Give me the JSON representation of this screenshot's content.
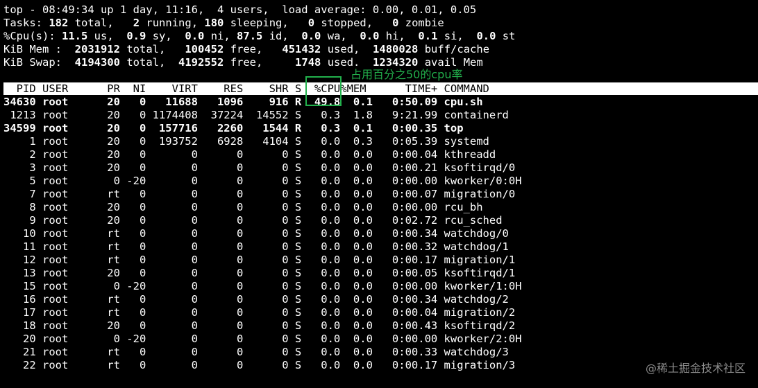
{
  "summary": {
    "line1": "top - 08:49:34 up 1 day, 11:16,  4 users,  load average: 0.00, 0.01, 0.05",
    "tasks": {
      "label": "Tasks:",
      "total": "182",
      "total_label": "total,",
      "running": "2",
      "running_label": "running,",
      "sleeping": "180",
      "sleeping_label": "sleeping,",
      "stopped": "0",
      "stopped_label": "stopped,",
      "zombie": "0",
      "zombie_label": "zombie"
    },
    "cpu": {
      "label": "%Cpu(s):",
      "us": "11.5",
      "us_label": "us,",
      "sy": "0.9",
      "sy_label": "sy,",
      "ni": "0.0",
      "ni_label": "ni,",
      "id": "87.5",
      "id_label": "id,",
      "wa": "0.0",
      "wa_label": "wa,",
      "hi": "0.0",
      "hi_label": "hi,",
      "si": "0.1",
      "si_label": "si,",
      "st": "0.0",
      "st_label": "st"
    },
    "mem": {
      "label": "KiB Mem :",
      "total": "2031912",
      "total_label": "total,",
      "free": "100452",
      "free_label": "free,",
      "used": "451432",
      "used_label": "used,",
      "buff": "1480028",
      "buff_label": "buff/cache"
    },
    "swap": {
      "label": "KiB Swap:",
      "total": "4194300",
      "total_label": "total,",
      "free": "4192552",
      "free_label": "free,",
      "used": "1748",
      "used_label": "used.",
      "avail": "1234320",
      "avail_label": "avail Mem"
    }
  },
  "columns": [
    "PID",
    "USER",
    "PR",
    "NI",
    "VIRT",
    "RES",
    "SHR",
    "S",
    "%CPU",
    "%MEM",
    "TIME+",
    "COMMAND"
  ],
  "processes": [
    {
      "pid": "34630",
      "user": "root",
      "pr": "20",
      "ni": "0",
      "virt": "11688",
      "res": "1096",
      "shr": "916",
      "s": "R",
      "cpu": "49.8",
      "mem": "0.1",
      "time": "0:50.09",
      "cmd": "cpu.sh",
      "bold": true
    },
    {
      "pid": "1213",
      "user": "root",
      "pr": "20",
      "ni": "0",
      "virt": "1174408",
      "res": "37224",
      "shr": "14552",
      "s": "S",
      "cpu": "0.3",
      "mem": "1.8",
      "time": "9:21.99",
      "cmd": "containerd",
      "bold": false
    },
    {
      "pid": "34599",
      "user": "root",
      "pr": "20",
      "ni": "0",
      "virt": "157716",
      "res": "2260",
      "shr": "1544",
      "s": "R",
      "cpu": "0.3",
      "mem": "0.1",
      "time": "0:00.35",
      "cmd": "top",
      "bold": true
    },
    {
      "pid": "1",
      "user": "root",
      "pr": "20",
      "ni": "0",
      "virt": "193752",
      "res": "6928",
      "shr": "4104",
      "s": "S",
      "cpu": "0.0",
      "mem": "0.3",
      "time": "0:05.39",
      "cmd": "systemd",
      "bold": false
    },
    {
      "pid": "2",
      "user": "root",
      "pr": "20",
      "ni": "0",
      "virt": "0",
      "res": "0",
      "shr": "0",
      "s": "S",
      "cpu": "0.0",
      "mem": "0.0",
      "time": "0:00.04",
      "cmd": "kthreadd",
      "bold": false
    },
    {
      "pid": "3",
      "user": "root",
      "pr": "20",
      "ni": "0",
      "virt": "0",
      "res": "0",
      "shr": "0",
      "s": "S",
      "cpu": "0.0",
      "mem": "0.0",
      "time": "0:00.21",
      "cmd": "ksoftirqd/0",
      "bold": false
    },
    {
      "pid": "5",
      "user": "root",
      "pr": "0",
      "ni": "-20",
      "virt": "0",
      "res": "0",
      "shr": "0",
      "s": "S",
      "cpu": "0.0",
      "mem": "0.0",
      "time": "0:00.00",
      "cmd": "kworker/0:0H",
      "bold": false
    },
    {
      "pid": "7",
      "user": "root",
      "pr": "rt",
      "ni": "0",
      "virt": "0",
      "res": "0",
      "shr": "0",
      "s": "S",
      "cpu": "0.0",
      "mem": "0.0",
      "time": "0:00.07",
      "cmd": "migration/0",
      "bold": false
    },
    {
      "pid": "8",
      "user": "root",
      "pr": "20",
      "ni": "0",
      "virt": "0",
      "res": "0",
      "shr": "0",
      "s": "S",
      "cpu": "0.0",
      "mem": "0.0",
      "time": "0:00.00",
      "cmd": "rcu_bh",
      "bold": false
    },
    {
      "pid": "9",
      "user": "root",
      "pr": "20",
      "ni": "0",
      "virt": "0",
      "res": "0",
      "shr": "0",
      "s": "S",
      "cpu": "0.0",
      "mem": "0.0",
      "time": "0:02.72",
      "cmd": "rcu_sched",
      "bold": false
    },
    {
      "pid": "10",
      "user": "root",
      "pr": "rt",
      "ni": "0",
      "virt": "0",
      "res": "0",
      "shr": "0",
      "s": "S",
      "cpu": "0.0",
      "mem": "0.0",
      "time": "0:00.34",
      "cmd": "watchdog/0",
      "bold": false
    },
    {
      "pid": "11",
      "user": "root",
      "pr": "rt",
      "ni": "0",
      "virt": "0",
      "res": "0",
      "shr": "0",
      "s": "S",
      "cpu": "0.0",
      "mem": "0.0",
      "time": "0:00.32",
      "cmd": "watchdog/1",
      "bold": false
    },
    {
      "pid": "12",
      "user": "root",
      "pr": "rt",
      "ni": "0",
      "virt": "0",
      "res": "0",
      "shr": "0",
      "s": "S",
      "cpu": "0.0",
      "mem": "0.0",
      "time": "0:00.17",
      "cmd": "migration/1",
      "bold": false
    },
    {
      "pid": "13",
      "user": "root",
      "pr": "20",
      "ni": "0",
      "virt": "0",
      "res": "0",
      "shr": "0",
      "s": "S",
      "cpu": "0.0",
      "mem": "0.0",
      "time": "0:00.05",
      "cmd": "ksoftirqd/1",
      "bold": false
    },
    {
      "pid": "15",
      "user": "root",
      "pr": "0",
      "ni": "-20",
      "virt": "0",
      "res": "0",
      "shr": "0",
      "s": "S",
      "cpu": "0.0",
      "mem": "0.0",
      "time": "0:00.00",
      "cmd": "kworker/1:0H",
      "bold": false
    },
    {
      "pid": "16",
      "user": "root",
      "pr": "rt",
      "ni": "0",
      "virt": "0",
      "res": "0",
      "shr": "0",
      "s": "S",
      "cpu": "0.0",
      "mem": "0.0",
      "time": "0:00.34",
      "cmd": "watchdog/2",
      "bold": false
    },
    {
      "pid": "17",
      "user": "root",
      "pr": "rt",
      "ni": "0",
      "virt": "0",
      "res": "0",
      "shr": "0",
      "s": "S",
      "cpu": "0.0",
      "mem": "0.0",
      "time": "0:00.04",
      "cmd": "migration/2",
      "bold": false
    },
    {
      "pid": "18",
      "user": "root",
      "pr": "20",
      "ni": "0",
      "virt": "0",
      "res": "0",
      "shr": "0",
      "s": "S",
      "cpu": "0.0",
      "mem": "0.0",
      "time": "0:00.43",
      "cmd": "ksoftirqd/2",
      "bold": false
    },
    {
      "pid": "20",
      "user": "root",
      "pr": "0",
      "ni": "-20",
      "virt": "0",
      "res": "0",
      "shr": "0",
      "s": "S",
      "cpu": "0.0",
      "mem": "0.0",
      "time": "0:00.00",
      "cmd": "kworker/2:0H",
      "bold": false
    },
    {
      "pid": "21",
      "user": "root",
      "pr": "rt",
      "ni": "0",
      "virt": "0",
      "res": "0",
      "shr": "0",
      "s": "S",
      "cpu": "0.0",
      "mem": "0.0",
      "time": "0:00.33",
      "cmd": "watchdog/3",
      "bold": false
    },
    {
      "pid": "22",
      "user": "root",
      "pr": "rt",
      "ni": "0",
      "virt": "0",
      "res": "0",
      "shr": "0",
      "s": "S",
      "cpu": "0.0",
      "mem": "0.0",
      "time": "0:00.17",
      "cmd": "migration/3",
      "bold": false
    }
  ],
  "annotation": {
    "text": "占用百分之50的cpu率",
    "color": "#22b14c"
  },
  "watermark": "@稀土掘金技术社区"
}
